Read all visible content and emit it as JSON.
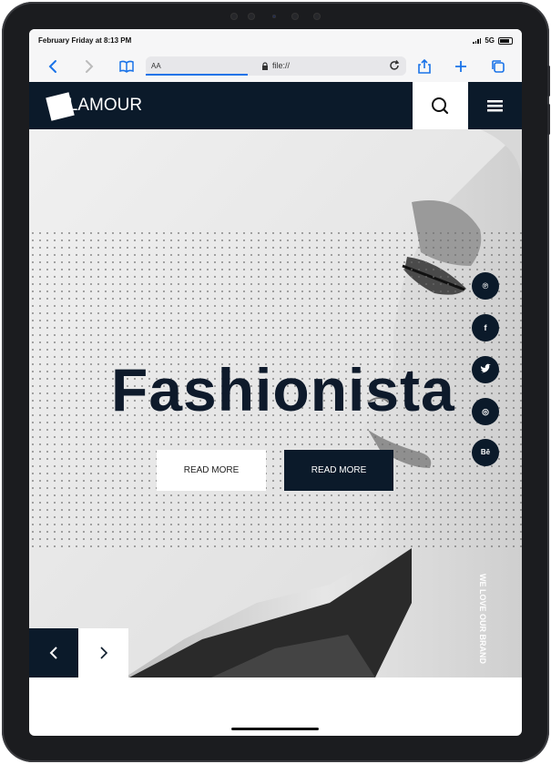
{
  "status_bar": {
    "time": "February Friday at 8:13 PM",
    "network": "5G"
  },
  "browser": {
    "text_size": "AA",
    "address": "file://"
  },
  "site": {
    "logo_text": "GLAMOUR",
    "headline": "Fashionista",
    "buttons": {
      "read_more_light": "READ MORE",
      "read_more_dark": "READ MORE"
    },
    "social": [
      {
        "name": "pinterest",
        "glyph": "℗"
      },
      {
        "name": "facebook",
        "glyph": "f"
      },
      {
        "name": "twitter",
        "glyph": "🐦"
      },
      {
        "name": "dribbble",
        "glyph": "◎"
      },
      {
        "name": "behance",
        "glyph": "Bē"
      }
    ],
    "vertical_tagline": "WE LOVE OUR BRAND"
  },
  "colors": {
    "brand_navy": "#0b1a2a",
    "accent_blue": "#1a73e8"
  }
}
